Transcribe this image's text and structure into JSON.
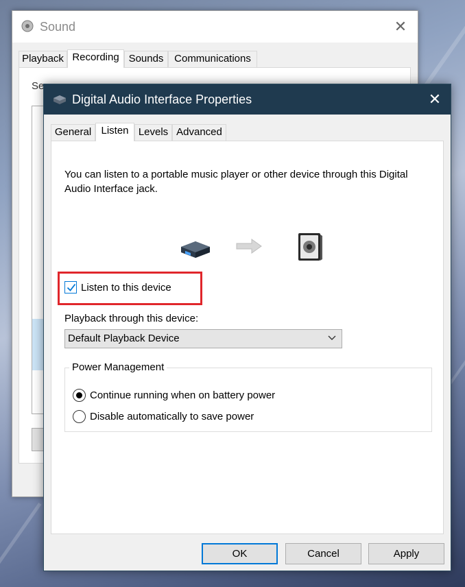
{
  "background_window": {
    "title": "Sound",
    "tabs": [
      "Playback",
      "Recording",
      "Sounds",
      "Communications"
    ],
    "active_tab": "Recording",
    "panel_text_fragment": "Se"
  },
  "dialog": {
    "title": "Digital Audio Interface Properties",
    "tabs": [
      "General",
      "Listen",
      "Levels",
      "Advanced"
    ],
    "active_tab": "Listen",
    "intro_text": "You can listen to a portable music player or other device through this Digital Audio Interface jack.",
    "listen_checkbox": {
      "label": "Listen to this device",
      "checked": true
    },
    "playback_label": "Playback through this device:",
    "playback_select": {
      "selected": "Default Playback Device"
    },
    "power_group": {
      "legend": "Power Management",
      "options": [
        {
          "label": "Continue running when on battery power",
          "selected": true
        },
        {
          "label": "Disable automatically to save power",
          "selected": false
        }
      ]
    },
    "buttons": {
      "ok": "OK",
      "cancel": "Cancel",
      "apply": "Apply"
    }
  },
  "colors": {
    "dialog_titlebar": "#1f3a4f",
    "accent": "#0078d7",
    "highlight": "#e0262b"
  },
  "icons": {
    "sound_app": "speaker-icon",
    "dialog_app": "audio-device-icon",
    "source_device": "audio-interface-icon",
    "arrow": "arrow-right-icon",
    "output_device": "speaker-icon",
    "close": "close-icon",
    "dropdown": "chevron-down-icon",
    "check": "checkmark-icon"
  }
}
